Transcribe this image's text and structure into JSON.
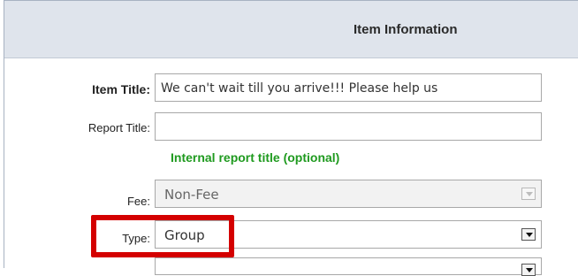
{
  "header": {
    "title": "Item Information"
  },
  "form": {
    "item_title": {
      "label": "Item Title:",
      "value": "We can't wait till you arrive!!!  Please help us"
    },
    "report_title": {
      "label": "Report Title:",
      "value": "",
      "hint": "Internal report title (optional)"
    },
    "fee": {
      "label": "Fee:",
      "value": "Non-Fee"
    },
    "type": {
      "label": "Type:",
      "value": "Group"
    }
  },
  "colors": {
    "header_bg": "#dfe4ec",
    "hint_green": "#1f9a1f",
    "highlight_red": "#d40000"
  }
}
